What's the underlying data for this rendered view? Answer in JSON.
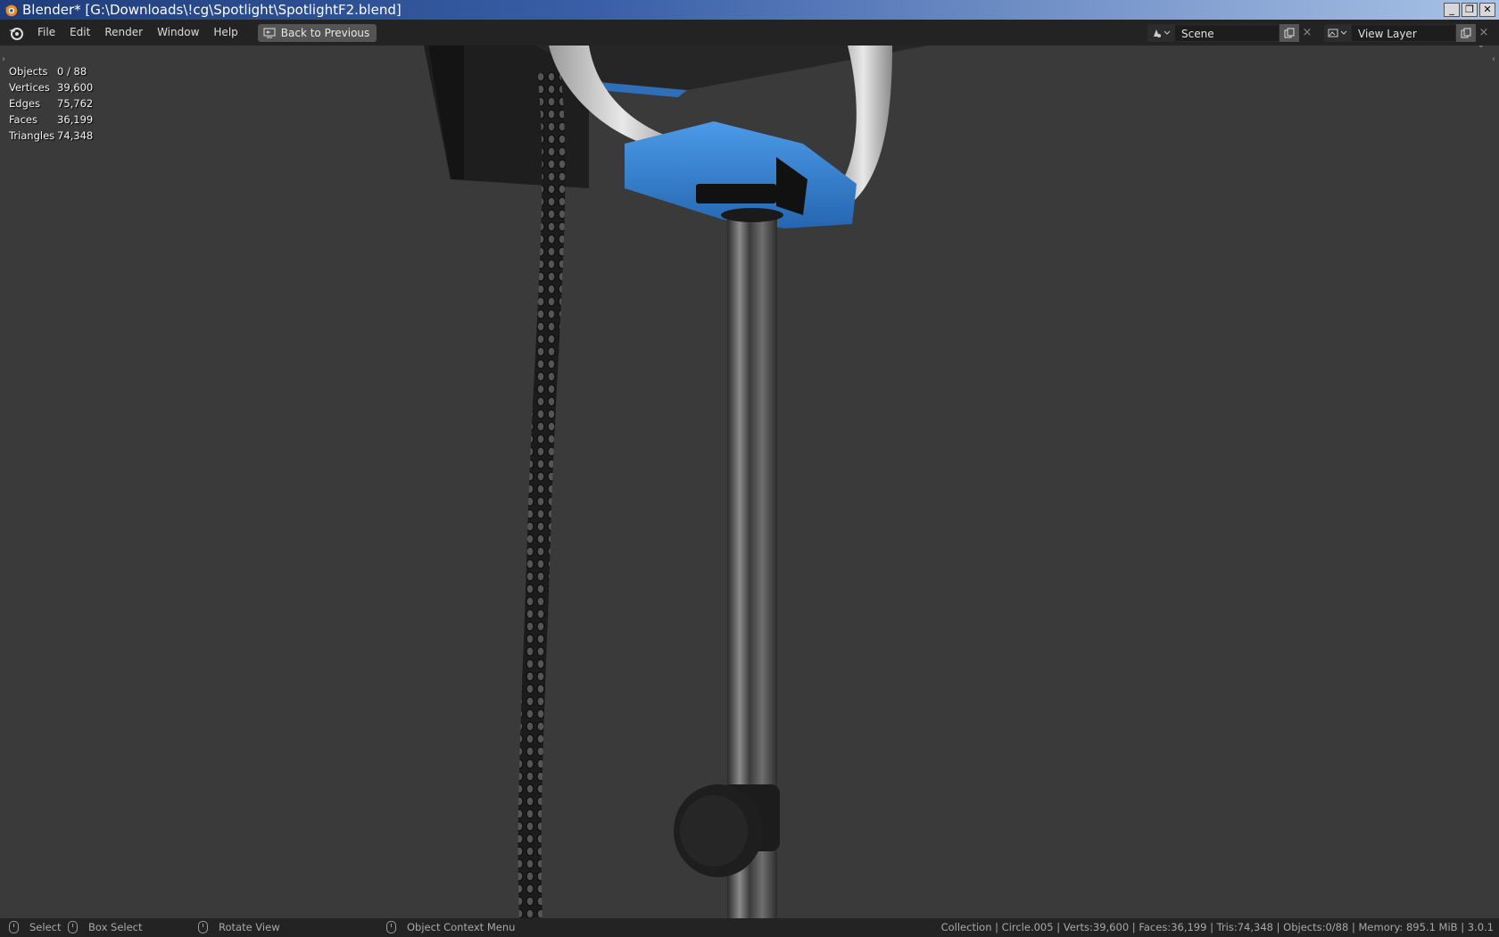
{
  "window": {
    "title": "Blender* [G:\\Downloads\\!cg\\Spotlight\\SpotlightF2.blend]",
    "minimize": "_",
    "restore": "❐",
    "close": "✕"
  },
  "menu": {
    "items": [
      "File",
      "Edit",
      "Render",
      "Window",
      "Help"
    ],
    "back_to_previous": "Back to Previous"
  },
  "scene_selector": {
    "value": "Scene"
  },
  "view_layer_selector": {
    "value": "View Layer"
  },
  "stats": {
    "rows": [
      {
        "label": "Objects",
        "value": "0 / 88"
      },
      {
        "label": "Vertices",
        "value": "39,600"
      },
      {
        "label": "Edges",
        "value": "75,762"
      },
      {
        "label": "Faces",
        "value": "36,199"
      },
      {
        "label": "Triangles",
        "value": "74,348"
      }
    ]
  },
  "statusbar": {
    "select": "Select",
    "box_select": "Box Select",
    "rotate_view": "Rotate View",
    "context_menu": "Object Context Menu",
    "info": "Collection | Circle.005 | Verts:39,600 | Faces:36,199 | Tris:74,348 | Objects:0/88 | Memory: 895.1 MiB | 3.0.1"
  },
  "colors": {
    "accent_blue": "#3b86d6",
    "viewport_bg": "#3a3a3a",
    "topbar_bg": "#232323"
  }
}
